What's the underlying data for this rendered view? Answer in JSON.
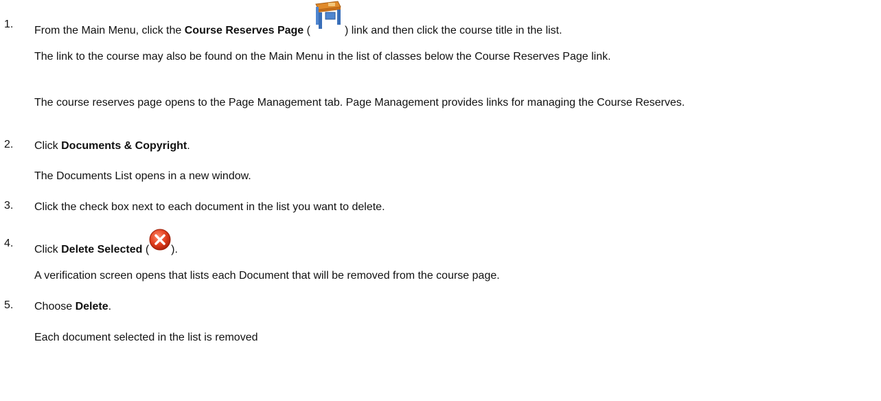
{
  "steps": [
    {
      "number": "1.",
      "pre": "From the Main Menu, click the ",
      "bold": "Course Reserves Page",
      "mid": " (",
      "icon": "desk-icon",
      "post": ") link and then click the course title in the list.",
      "notes": [
        "The link to the course may also be found on the Main Menu in the list of classes below the Course Reserves Page link.",
        "The course reserves page opens to the Page Management tab. Page Management provides links for managing the Course Reserves."
      ]
    },
    {
      "number": "2.",
      "pre": "Click ",
      "bold": "Documents & Copyright",
      "post": ".",
      "notes": [
        "The Documents List opens in a new window."
      ]
    },
    {
      "number": "3.",
      "text": "Click the check box next to each document in the list you want to delete."
    },
    {
      "number": "4.",
      "pre": "Click ",
      "bold": "Delete Selected",
      "mid": " (",
      "icon": "delete-x-icon",
      "post": ").",
      "notes": [
        "A verification screen opens that lists each Document that will be removed from the course page."
      ]
    },
    {
      "number": "5.",
      "pre": "Choose ",
      "bold": "Delete",
      "post": ".",
      "notes": [
        "Each document selected in the list is removed"
      ]
    }
  ]
}
